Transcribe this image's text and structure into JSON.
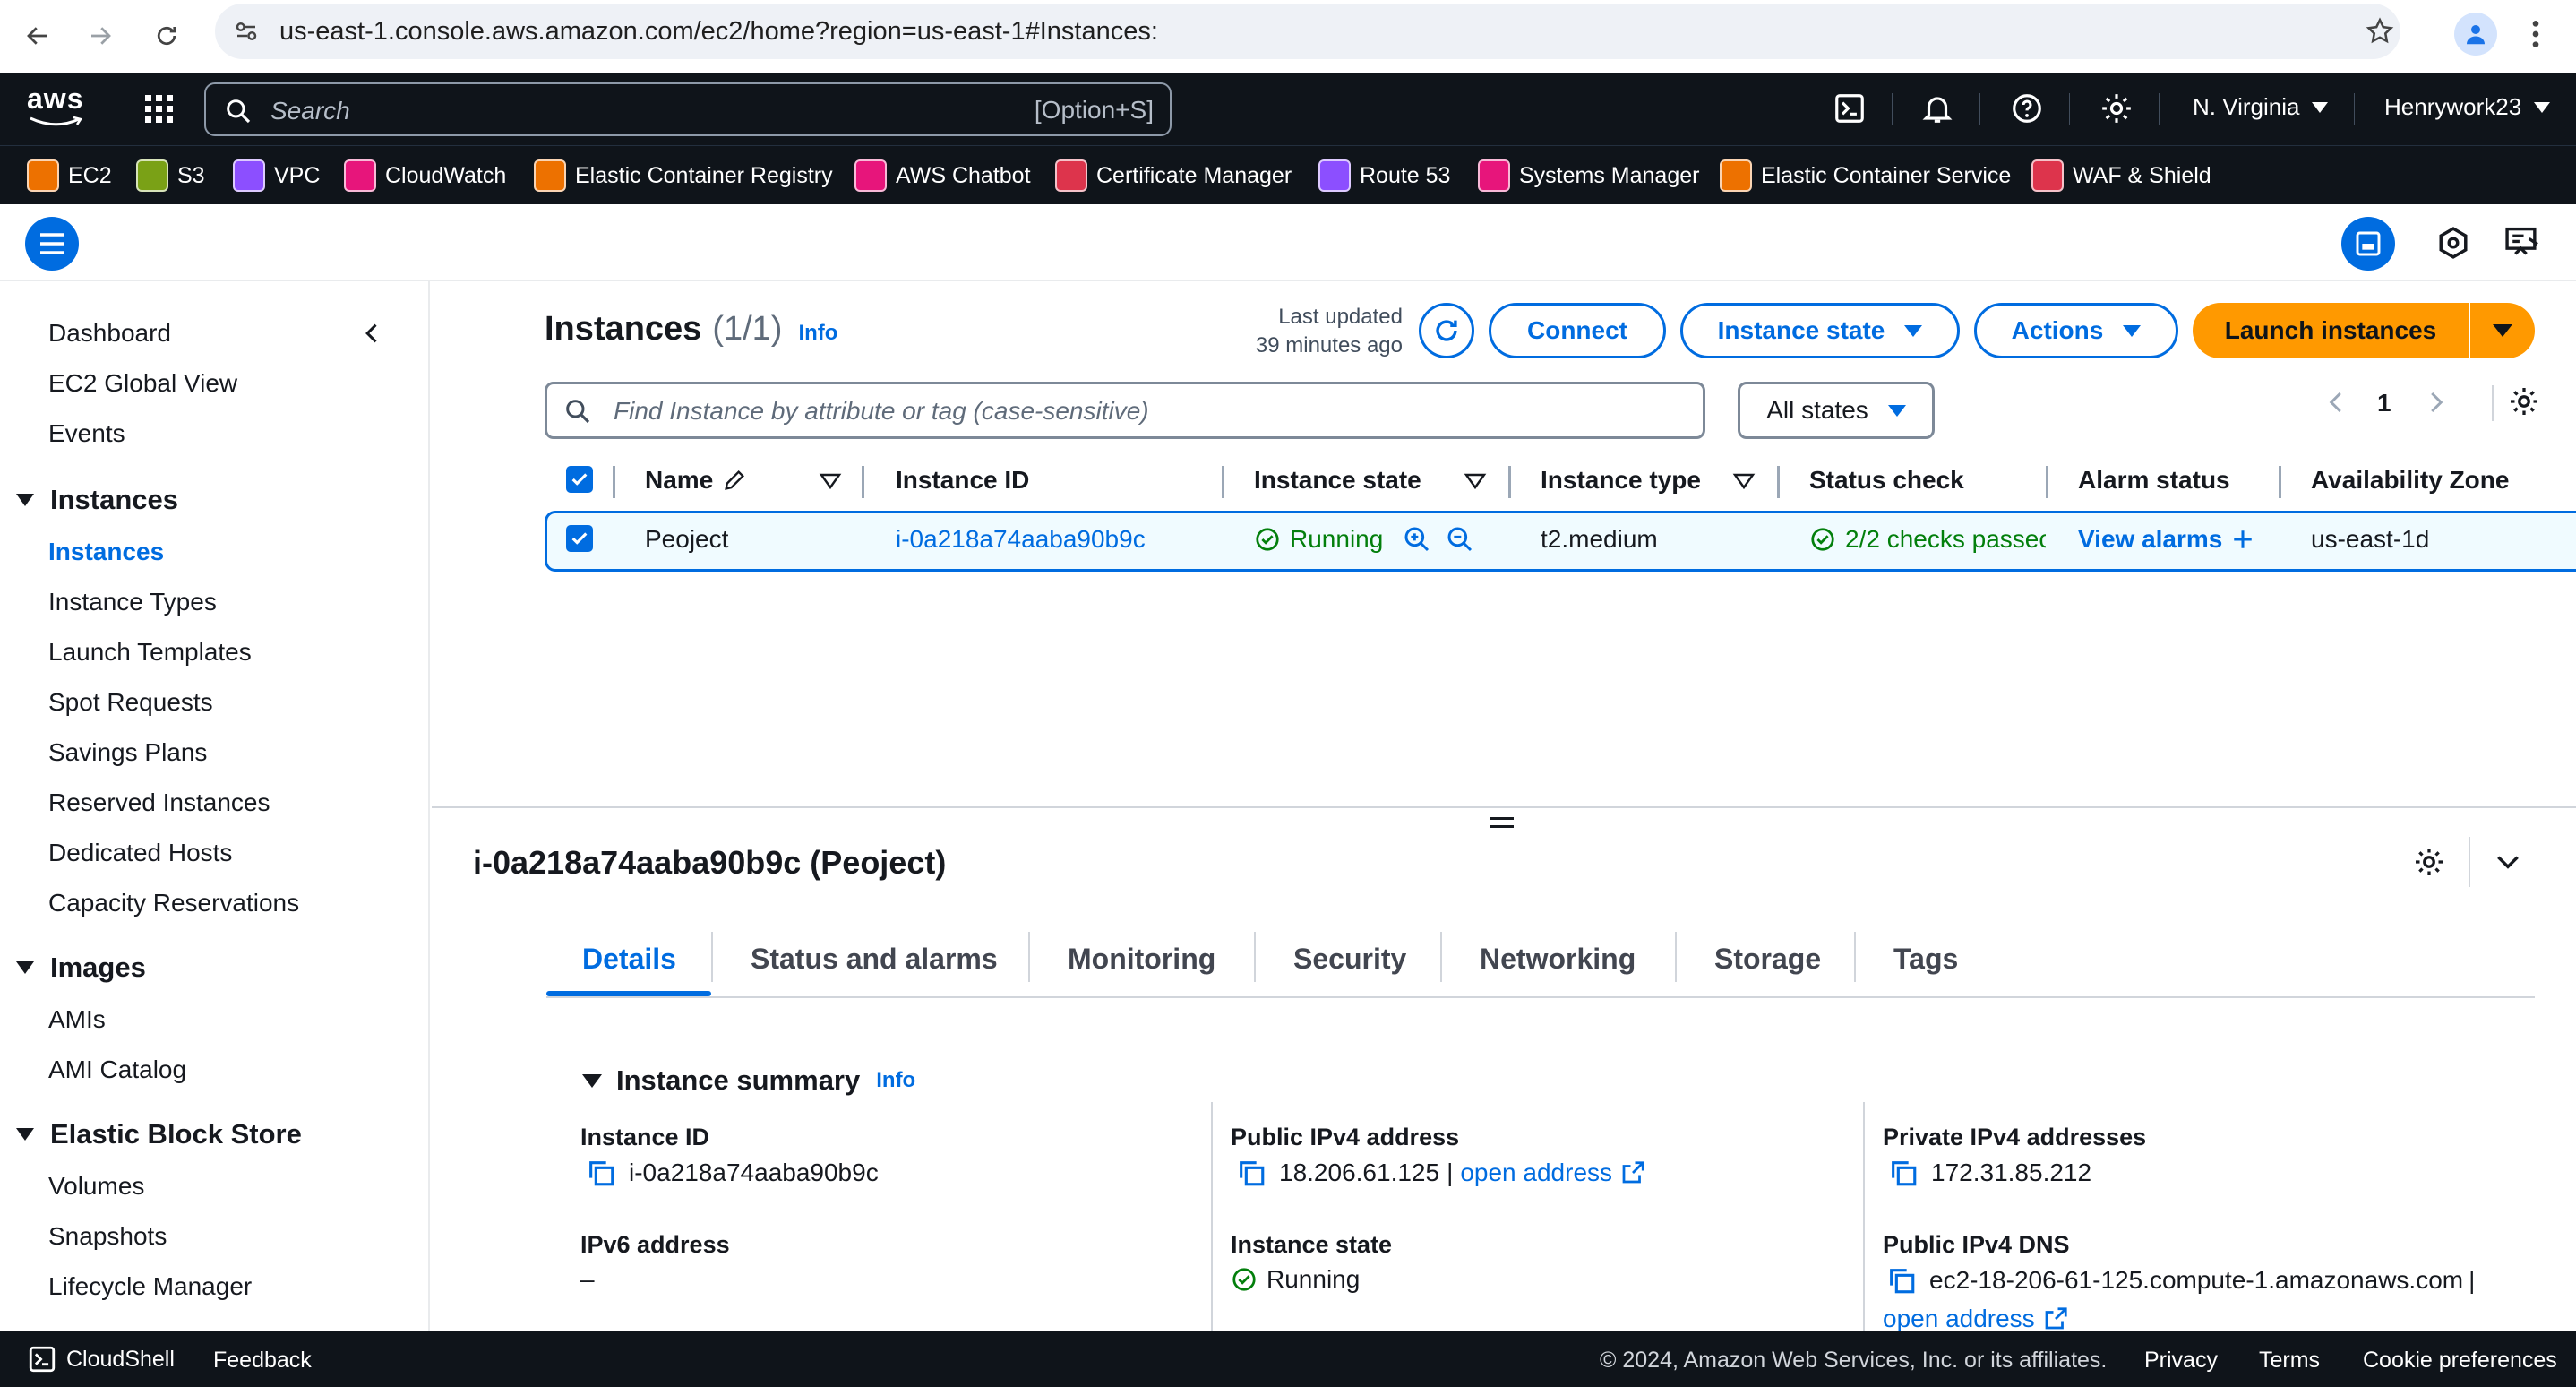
{
  "browser": {
    "url": "us-east-1.console.aws.amazon.com/ec2/home?region=us-east-1#Instances:"
  },
  "topnav": {
    "logo": "aws",
    "search_placeholder": "Search",
    "search_shortcut": "[Option+S]",
    "region": "N. Virginia",
    "account": "Henrywork23"
  },
  "favorites": [
    {
      "label": "EC2",
      "color": "#ed7100"
    },
    {
      "label": "S3",
      "color": "#7aa116"
    },
    {
      "label": "VPC",
      "color": "#8c4fff"
    },
    {
      "label": "CloudWatch",
      "color": "#e7157b"
    },
    {
      "label": "Elastic Container Registry",
      "color": "#ed7100"
    },
    {
      "label": "AWS Chatbot",
      "color": "#e7157b"
    },
    {
      "label": "Certificate Manager",
      "color": "#dd344c"
    },
    {
      "label": "Route 53",
      "color": "#8c4fff"
    },
    {
      "label": "Systems Manager",
      "color": "#e7157b"
    },
    {
      "label": "Elastic Container Service",
      "color": "#ed7100"
    },
    {
      "label": "WAF & Shield",
      "color": "#dd344c"
    }
  ],
  "sidebar": {
    "top_items": [
      "Dashboard",
      "EC2 Global View",
      "Events"
    ],
    "instances_heading": "Instances",
    "instances_items": [
      "Instances",
      "Instance Types",
      "Launch Templates",
      "Spot Requests",
      "Savings Plans",
      "Reserved Instances",
      "Dedicated Hosts",
      "Capacity Reservations"
    ],
    "images_heading": "Images",
    "images_items": [
      "AMIs",
      "AMI Catalog"
    ],
    "ebs_heading": "Elastic Block Store",
    "ebs_items": [
      "Volumes",
      "Snapshots",
      "Lifecycle Manager"
    ]
  },
  "instances_panel": {
    "title": "Instances",
    "count": "(1/1)",
    "info": "Info",
    "last_updated_line1": "Last updated",
    "last_updated_line2": "39 minutes ago",
    "connect": "Connect",
    "instance_state": "Instance state",
    "actions": "Actions",
    "launch": "Launch instances",
    "filter_placeholder": "Find Instance by attribute or tag (case-sensitive)",
    "states_filter": "All states",
    "page": "1",
    "columns": [
      "Name",
      "Instance ID",
      "Instance state",
      "Instance type",
      "Status check",
      "Alarm status",
      "Availability Zone"
    ],
    "row": {
      "name": "Peoject",
      "id": "i-0a218a74aaba90b9c",
      "state": "Running",
      "type": "t2.medium",
      "status": "2/2 checks passec",
      "alarm": "View alarms",
      "az": "us-east-1d"
    }
  },
  "detail": {
    "title": "i-0a218a74aaba90b9c (Peoject)",
    "tabs": [
      "Details",
      "Status and alarms",
      "Monitoring",
      "Security",
      "Networking",
      "Storage",
      "Tags"
    ],
    "summary_title": "Instance summary",
    "summary_info": "Info",
    "instance_id_label": "Instance ID",
    "instance_id": "i-0a218a74aaba90b9c",
    "ipv6_label": "IPv6 address",
    "ipv6": "–",
    "public_ipv4_label": "Public IPv4 address",
    "public_ipv4": "18.206.61.125",
    "open_address": "open address",
    "state_label": "Instance state",
    "state": "Running",
    "private_ipv4_label": "Private IPv4 addresses",
    "private_ipv4": "172.31.85.212",
    "public_dns_label": "Public IPv4 DNS",
    "public_dns": "ec2-18-206-61-125.compute-1.amazonaws.com",
    "open_address_2": "open address"
  },
  "footer": {
    "cloudshell": "CloudShell",
    "feedback": "Feedback",
    "copyright": "© 2024, Amazon Web Services, Inc. or its affiliates.",
    "privacy": "Privacy",
    "terms": "Terms",
    "cookies": "Cookie preferences"
  },
  "colors": {
    "accent": "#006ce0",
    "launch": "#ff9900",
    "running": "#037f0c",
    "nav_bg": "#0f141a"
  }
}
